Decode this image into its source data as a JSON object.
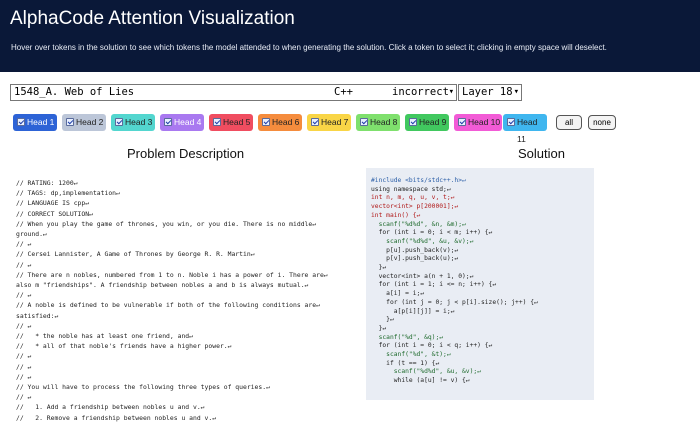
{
  "header": {
    "title": "AlphaCode Attention Visualization",
    "subtitle": "Hover over tokens in the solution to see which tokens the model attended to when generating the solution. Click a token to select it; clicking in empty space will deselect."
  },
  "selector": {
    "problem_name": "1548_A. Web of Lies",
    "language": "C++",
    "verdict": "incorrect",
    "layer": "Layer 18"
  },
  "heads": [
    {
      "label": "Head 1",
      "color": "#2d63d6",
      "text_color": "#ffffff"
    },
    {
      "label": "Head 2",
      "color": "#bcc6d8",
      "text_color": "#222222"
    },
    {
      "label": "Head 3",
      "color": "#53d6cf",
      "text_color": "#222222"
    },
    {
      "label": "Head 4",
      "color": "#a979f0",
      "text_color": "#ffffff"
    },
    {
      "label": "Head 5",
      "color": "#f04d60",
      "text_color": "#222222"
    },
    {
      "label": "Head 6",
      "color": "#f58c3d",
      "text_color": "#222222"
    },
    {
      "label": "Head 7",
      "color": "#f9d546",
      "text_color": "#222222"
    },
    {
      "label": "Head 8",
      "color": "#7fe06d",
      "text_color": "#222222"
    },
    {
      "label": "Head 9",
      "color": "#41c85f",
      "text_color": "#222222"
    },
    {
      "label": "Head 10",
      "color": "#f25bd6",
      "text_color": "#222222"
    },
    {
      "label": "Head 11",
      "color": "#3fb6ef",
      "text_color": "#222222"
    }
  ],
  "buttons": {
    "all": "all",
    "none": "none"
  },
  "problem": {
    "title": "Problem Description",
    "lines": [
      "// RATING: 1200↵",
      "// TAGS: dp,implementation↵",
      "// LANGUAGE IS cpp↵",
      "// CORRECT SOLUTION↵",
      "// When you play the game of thrones, you win, or you die. There is no middle↵",
      "ground.↵",
      "// ↵",
      "// Cersei Lannister, A Game of Thrones by George R. R. Martin↵",
      "// ↵",
      "// There are n nobles, numbered from 1 to n. Noble i has a power of i. There are↵",
      "also m \"friendships\". A friendship between nobles a and b is always mutual.↵",
      "// ↵",
      "// A noble is defined to be vulnerable if both of the following conditions are↵",
      "satisfied:↵",
      "// ↵",
      "//   * the noble has at least one friend, and↵",
      "//   * all of that noble's friends have a higher power.↵",
      "// ↵",
      "// ↵",
      "// ↵",
      "// You will have to process the following three types of queries.↵",
      "// ↵",
      "//   1. Add a friendship between nobles u and v.↵",
      "//   2. Remove a friendship between nobles u and v.↵"
    ]
  },
  "solution": {
    "title": "Solution",
    "lines": [
      "#include <bits/stdc++.h>↵",
      "using namespace std;↵",
      "int n, m, q, u, v, t;↵",
      "vector<int> p[200001];↵",
      "int main() {↵",
      "  scanf(\"%d%d\", &n, &m);↵",
      "  for (int i = 0; i < m; i++) {↵",
      "    scanf(\"%d%d\", &u, &v);↵",
      "    p[u].push_back(v);↵",
      "    p[v].push_back(u);↵",
      "  }↵",
      "  vector<int> a(n + 1, 0);↵",
      "  for (int i = 1; i <= n; i++) {↵",
      "    a[i] = i;↵",
      "    for (int j = 0; j < p[i].size(); j++) {↵",
      "      a[p[i][j]] = i;↵",
      "    }↵",
      "  }↵",
      "  scanf(\"%d\", &q);↵",
      "  for (int i = 0; i < q; i++) {↵",
      "    scanf(\"%d\", &t);↵",
      "    if (t == 1) {↵",
      "      scanf(\"%d%d\", &u, &v);↵",
      "      while (a[u] != v) {↵"
    ]
  }
}
